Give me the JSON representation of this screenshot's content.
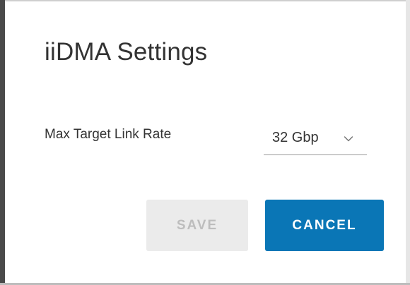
{
  "dialog": {
    "title": "iiDMA Settings",
    "field": {
      "label": "Max Target Link Rate",
      "selected_value": "32 Gbp",
      "chevron_icon": "chevron-down-icon"
    },
    "buttons": {
      "save_label": "SAVE",
      "save_enabled": false,
      "cancel_label": "CANCEL"
    }
  },
  "colors": {
    "primary": "#0a76b6",
    "disabled_bg": "#ebebeb",
    "disabled_text": "#bdbdbd",
    "text": "#333333"
  }
}
